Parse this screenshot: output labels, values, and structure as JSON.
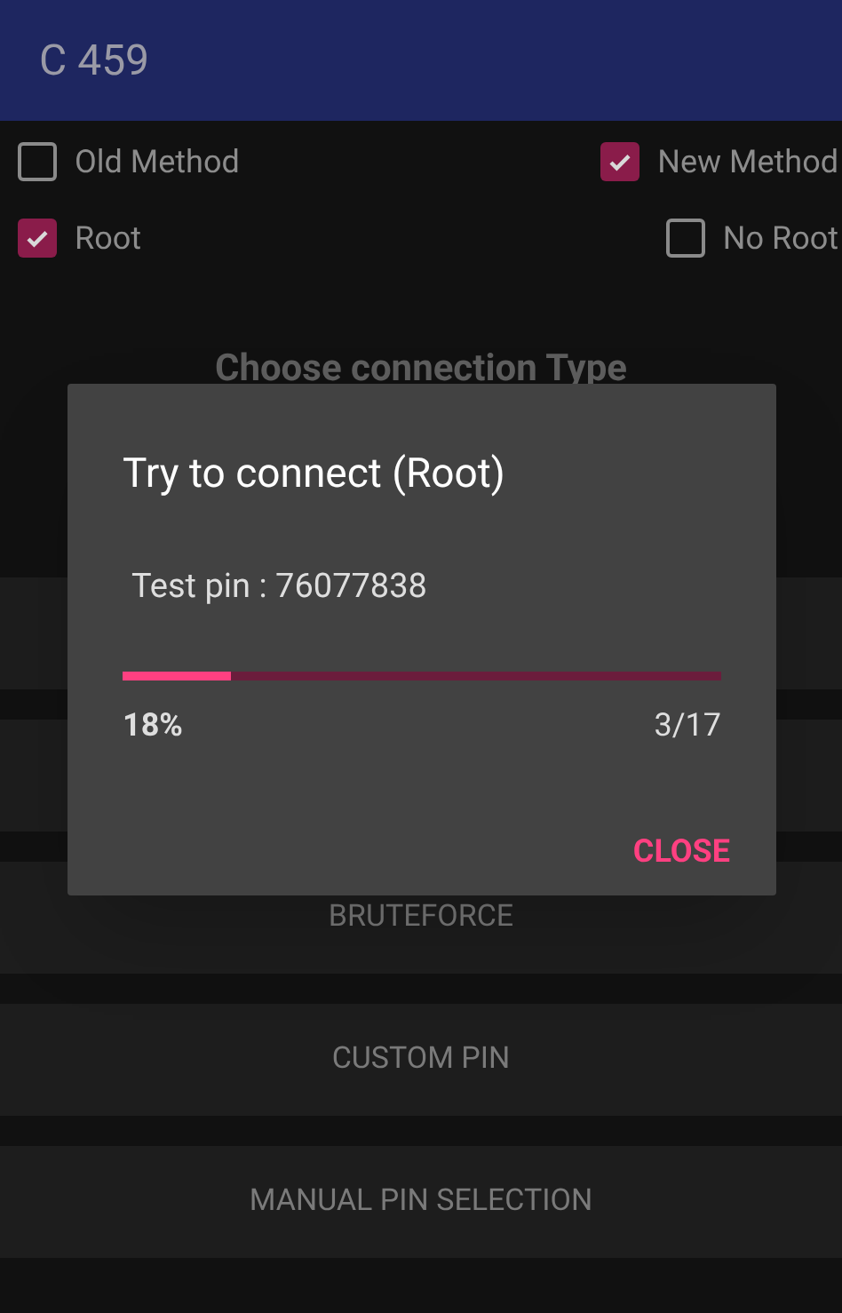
{
  "app_bar": {
    "title": "C 459"
  },
  "options": [
    {
      "label": "Old Method",
      "checked": false
    },
    {
      "label": "New Method",
      "checked": true
    },
    {
      "label": "Root",
      "checked": true
    },
    {
      "label": "No Root",
      "checked": false
    }
  ],
  "section_title": "Choose connection Type",
  "buttons": [
    {
      "kind": "covered"
    },
    {
      "kind": "covered"
    },
    {
      "kind": "text",
      "label": "BRUTEFORCE"
    },
    {
      "kind": "text",
      "label": "CUSTOM PIN"
    },
    {
      "kind": "text",
      "label": "MANUAL PIN SELECTION"
    }
  ],
  "dialog": {
    "title": "Try to connect (Root)",
    "message": "Test pin : 76077838",
    "level": 0.18,
    "percent": "18%",
    "count": "3/17",
    "action": "CLOSE"
  }
}
